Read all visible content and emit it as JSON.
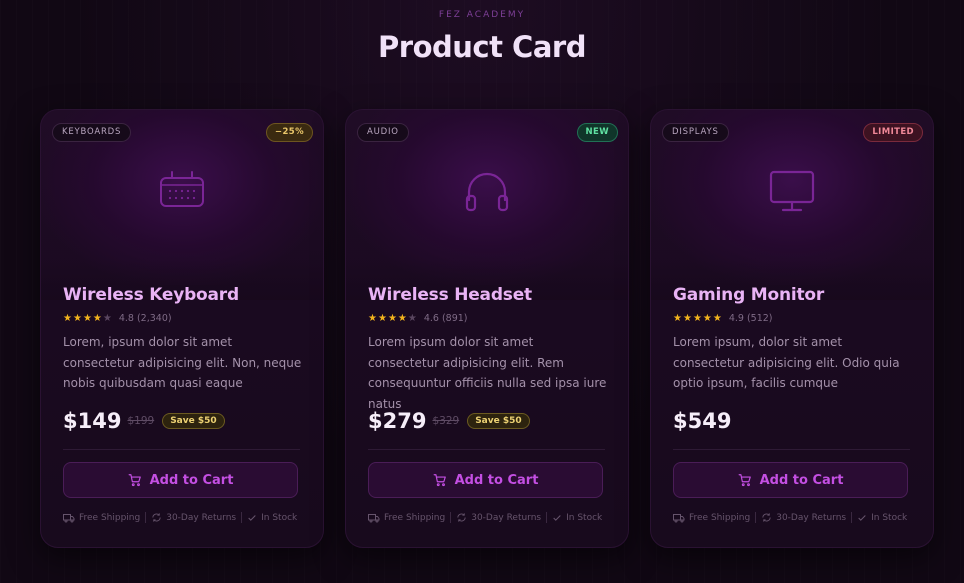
{
  "header": {
    "eyebrow": "FEZ ACADEMY",
    "title": "Product Card"
  },
  "colors": {
    "accent": "#c44fe3",
    "product_name": "#e9b3f5",
    "star": "#f3b41d"
  },
  "cards": [
    {
      "category": "KEYBOARDS",
      "badge": "−25%",
      "badge_type": "discount",
      "icon": "keyboard-icon",
      "name": "Wireless Keyboard",
      "rating": 4,
      "rating_text": "4.8 (2,340)",
      "description": "Lorem, ipsum dolor sit amet consectetur adipisicing elit. Non, neque nobis quibusdam quasi eaque",
      "price": "$149",
      "old_price": "$199",
      "save": "Save $50",
      "cta": "Add to Cart",
      "perks": [
        "Free Shipping",
        "30-Day Returns",
        "In Stock"
      ]
    },
    {
      "category": "AUDIO",
      "badge": "NEW",
      "badge_type": "new",
      "icon": "headphones-icon",
      "name": "Wireless Headset",
      "rating": 4,
      "rating_text": "4.6 (891)",
      "description": "Lorem ipsum dolor sit amet consectetur adipisicing elit. Rem consequuntur officiis nulla sed ipsa iure natus",
      "price": "$279",
      "old_price": "$329",
      "save": "Save $50",
      "cta": "Add to Cart",
      "perks": [
        "Free Shipping",
        "30-Day Returns",
        "In Stock"
      ]
    },
    {
      "category": "DISPLAYS",
      "badge": "LIMITED",
      "badge_type": "limited",
      "icon": "monitor-icon",
      "name": "Gaming Monitor",
      "rating": 5,
      "rating_text": "4.9 (512)",
      "description": "Lorem ipsum, dolor sit amet consectetur adipisicing elit. Odio quia optio ipsum, facilis cumque",
      "price": "$549",
      "old_price": "",
      "save": "",
      "cta": "Add to Cart",
      "perks": [
        "Free Shipping",
        "30-Day Returns",
        "In Stock"
      ]
    }
  ]
}
